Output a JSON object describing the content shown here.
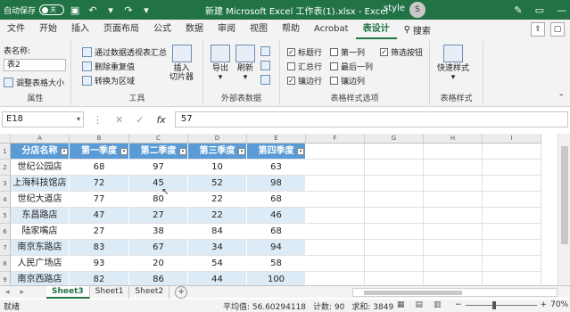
{
  "titlebar": {
    "autosave_label": "自动保存",
    "autosave_state": "关",
    "title": "新建 Microsoft Excel 工作表(1).xlsx  -  Excel",
    "user": "style",
    "avatar": "S",
    "colors": {
      "bar": "#217346",
      "text": "#ffffff"
    }
  },
  "tabs": {
    "items": [
      "文件",
      "开始",
      "插入",
      "页面布局",
      "公式",
      "数据",
      "审阅",
      "视图",
      "帮助",
      "Acrobat",
      "表设计"
    ],
    "active": "表设计",
    "search_label": "搜索"
  },
  "ribbon": {
    "properties": {
      "table_name_label": "表名称:",
      "table_name_value": "表2",
      "resize_label": "调整表格大小",
      "group_label": "属性"
    },
    "tools": {
      "summarize_pivot": "通过数据透视表汇总",
      "remove_duplicates": "删除重复值",
      "convert_to_range": "转换为区域",
      "insert_slicer_line1": "插入",
      "insert_slicer_line2": "切片器",
      "group_label": "工具"
    },
    "external": {
      "export_label": "导出",
      "refresh_label": "刷新",
      "group_label": "外部表数据"
    },
    "style_options": {
      "header_row": {
        "label": "标题行",
        "checked": true
      },
      "total_row": {
        "label": "汇总行",
        "checked": false
      },
      "banded_rows": {
        "label": "镶边行",
        "checked": true
      },
      "first_column": {
        "label": "第一列",
        "checked": false
      },
      "last_column": {
        "label": "最后一列",
        "checked": false
      },
      "banded_columns": {
        "label": "镶边列",
        "checked": false
      },
      "filter_button": {
        "label": "筛选按钮",
        "checked": true
      },
      "group_label": "表格样式选项"
    },
    "table_styles": {
      "quick_styles": "快速样式",
      "group_label": "表格样式"
    }
  },
  "formula_bar": {
    "name_box": "E18",
    "value": "57",
    "cancel_icon": "✕",
    "enter_icon": "✓",
    "fx": "fx"
  },
  "sheet": {
    "column_letters": [
      "A",
      "B",
      "C",
      "D",
      "E",
      "F",
      "G",
      "H",
      "I"
    ],
    "row_numbers": [
      "1",
      "2",
      "3",
      "4",
      "5",
      "6",
      "7",
      "8",
      "9"
    ],
    "table_headers": [
      "分店名称",
      "第一季度",
      "第二季度",
      "第三季度",
      "第四季度"
    ],
    "rows": [
      [
        "世纪公园店",
        "68",
        "97",
        "10",
        "63"
      ],
      [
        "上海科技馆店",
        "72",
        "45",
        "52",
        "98"
      ],
      [
        "世纪大道店",
        "77",
        "80",
        "22",
        "68"
      ],
      [
        "东昌路店",
        "47",
        "27",
        "22",
        "46"
      ],
      [
        "陆家嘴店",
        "27",
        "38",
        "84",
        "68"
      ],
      [
        "南京东路店",
        "83",
        "67",
        "34",
        "94"
      ],
      [
        "人民广场店",
        "93",
        "20",
        "54",
        "58"
      ],
      [
        "南京西路店",
        "82",
        "86",
        "44",
        "100"
      ]
    ],
    "colors": {
      "header": "#5b9bd5",
      "band": "#ddebf7"
    }
  },
  "sheet_tabs": {
    "items": [
      "Sheet3",
      "Sheet1",
      "Sheet2"
    ],
    "active": "Sheet3",
    "add": "+"
  },
  "status_bar": {
    "mode": "就绪",
    "average": "平均值: 56.60294118",
    "count": "计数: 90",
    "sum": "求和: 3849",
    "zoom": "70%",
    "zoom_minus": "−",
    "zoom_plus": "+"
  }
}
